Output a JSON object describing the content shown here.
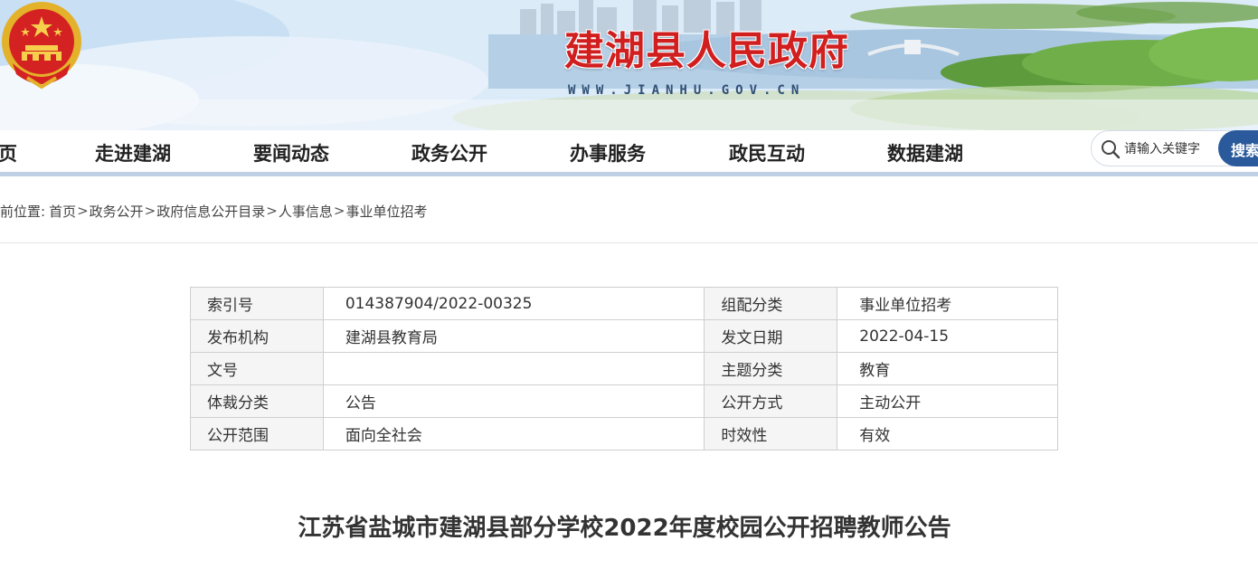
{
  "header": {
    "site_title": "建湖县人民政府",
    "site_url": "WWW.JIANHU.GOV.CN"
  },
  "nav": {
    "items": [
      {
        "label": "页"
      },
      {
        "label": "走进建湖"
      },
      {
        "label": "要闻动态"
      },
      {
        "label": "政务公开"
      },
      {
        "label": "办事服务"
      },
      {
        "label": "政民互动"
      },
      {
        "label": "数据建湖"
      }
    ]
  },
  "search": {
    "placeholder": "请输入关键字",
    "button_label": "搜索"
  },
  "breadcrumb": {
    "prefix": "前位置:",
    "items": [
      "首页",
      "政务公开",
      "政府信息公开目录",
      "人事信息",
      "事业单位招考"
    ],
    "separator": ">"
  },
  "meta": {
    "rows": [
      {
        "l1": "索引号",
        "v1": "014387904/2022-00325",
        "l2": "组配分类",
        "v2": "事业单位招考"
      },
      {
        "l1": "发布机构",
        "v1": "建湖县教育局",
        "l2": "发文日期",
        "v2": "2022-04-15"
      },
      {
        "l1": "文号",
        "v1": "",
        "l2": "主题分类",
        "v2": "教育"
      },
      {
        "l1": "体裁分类",
        "v1": "公告",
        "l2": "公开方式",
        "v2": "主动公开"
      },
      {
        "l1": "公开范围",
        "v1": "面向全社会",
        "l2": "时效性",
        "v2": "有效"
      }
    ]
  },
  "article": {
    "title": "江苏省盐城市建湖县部分学校2022年度校园公开招聘教师公告"
  },
  "colors": {
    "brand_red": "#d11e1e",
    "nav_bar": "#bfd0e4",
    "search_button": "#2a5a9b"
  }
}
